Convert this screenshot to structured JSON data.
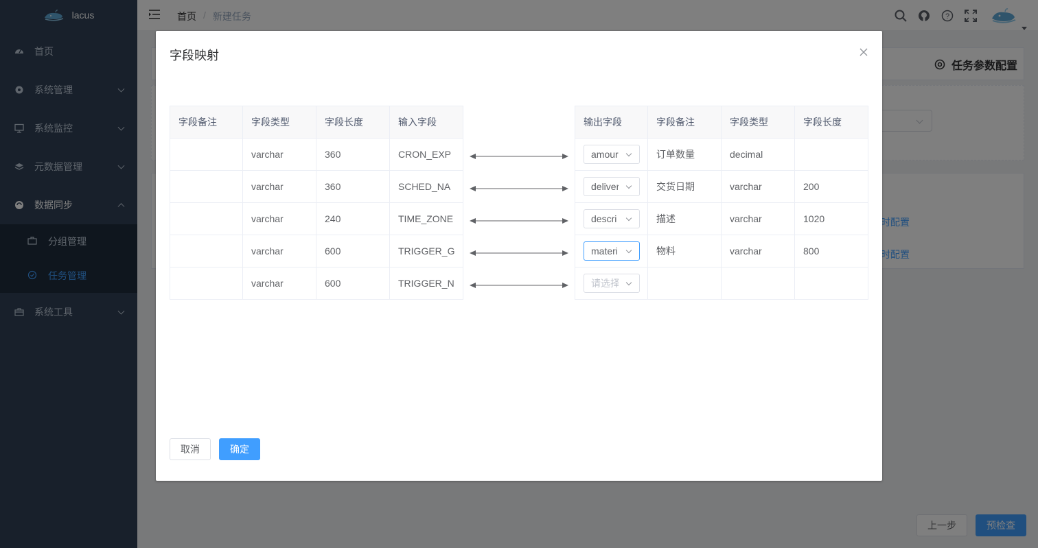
{
  "sidebar": {
    "brand": "lacus",
    "items": [
      {
        "label": "首页",
        "icon": "dashboard-icon"
      },
      {
        "label": "系统管理",
        "icon": "gear-icon"
      },
      {
        "label": "系统监控",
        "icon": "monitor-icon"
      },
      {
        "label": "元数据管理",
        "icon": "layers-icon"
      },
      {
        "label": "数据同步",
        "icon": "sync-icon"
      },
      {
        "label": "系统工具",
        "icon": "toolbox-icon"
      }
    ],
    "subitems": [
      {
        "label": "分组管理",
        "icon": "briefcase-icon"
      },
      {
        "label": "任务管理",
        "icon": "check-circle-icon",
        "active": true
      }
    ]
  },
  "navbar": {
    "breadcrumb": [
      "首页",
      "新建任务"
    ],
    "separator": "/"
  },
  "page": {
    "config_title": "任务参数配置",
    "link_text_1": "时配置",
    "link_text_2": "时配置",
    "prev_button": "上一步",
    "check_button": "预检查"
  },
  "dialog": {
    "title": "字段映射",
    "left_headers": [
      "字段备注",
      "字段类型",
      "字段长度",
      "输入字段"
    ],
    "left_rows": [
      [
        "",
        "varchar",
        "360",
        "CRON_EXP"
      ],
      [
        "",
        "varchar",
        "360",
        "SCHED_NA"
      ],
      [
        "",
        "varchar",
        "240",
        "TIME_ZONE"
      ],
      [
        "",
        "varchar",
        "600",
        "TRIGGER_G"
      ],
      [
        "",
        "varchar",
        "600",
        "TRIGGER_N"
      ]
    ],
    "right_headers": [
      "输出字段",
      "字段备注",
      "字段类型",
      "字段长度"
    ],
    "right_rows": [
      {
        "select": "amour",
        "remark": "订单数量",
        "type": "decimal",
        "length": ""
      },
      {
        "select": "deliver",
        "remark": "交货日期",
        "type": "varchar",
        "length": "200"
      },
      {
        "select": "descri",
        "remark": "描述",
        "type": "varchar",
        "length": "1020"
      },
      {
        "select": "materi",
        "remark": "物料",
        "type": "varchar",
        "length": "800",
        "focused": true
      },
      {
        "select": "",
        "placeholder": "请选择",
        "remark": "",
        "type": "",
        "length": ""
      }
    ],
    "cancel_label": "取消",
    "confirm_label": "确定"
  },
  "colors": {
    "primary": "#409eff",
    "sidebar_bg": "#304156",
    "submenu_bg": "#1f2d3d"
  }
}
